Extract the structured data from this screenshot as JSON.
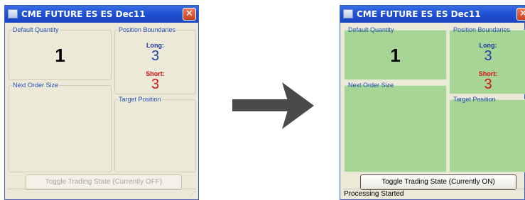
{
  "left_window": {
    "title": "CME FUTURE ES ES Dec11",
    "default_quantity_label": "Default Quantity",
    "default_quantity_value": "1",
    "position_boundaries_label": "Position Boundaries",
    "long_label": "Long:",
    "long_value": "3",
    "short_label": "Short:",
    "short_value": "3",
    "next_order_size_label": "Next Order Size",
    "target_position_label": "Target Position",
    "toggle_button_label": "Toggle Trading State (Currently OFF)",
    "status_text": "",
    "background_color": "#ece9d8"
  },
  "right_window": {
    "title": "CME FUTURE ES ES Dec11",
    "default_quantity_label": "Default Quantity",
    "default_quantity_value": "1",
    "position_boundaries_label": "Position Boundaries",
    "long_label": "Long:",
    "long_value": "3",
    "short_label": "Short:",
    "short_value": "3",
    "next_order_size_label": "Next Order Size",
    "target_position_label": "Target Position",
    "toggle_button_label": "Toggle Trading State (Currently ON)",
    "status_text": "Processing Started",
    "background_color": "#a7d595"
  },
  "icons": {
    "close": "close-icon",
    "app": "window-app-icon",
    "transition": "right-arrow-icon"
  },
  "colors": {
    "title_bar": "#1f52d6",
    "long": "#1c3f9e",
    "short": "#d21212",
    "arrow": "#4a4a4a"
  }
}
